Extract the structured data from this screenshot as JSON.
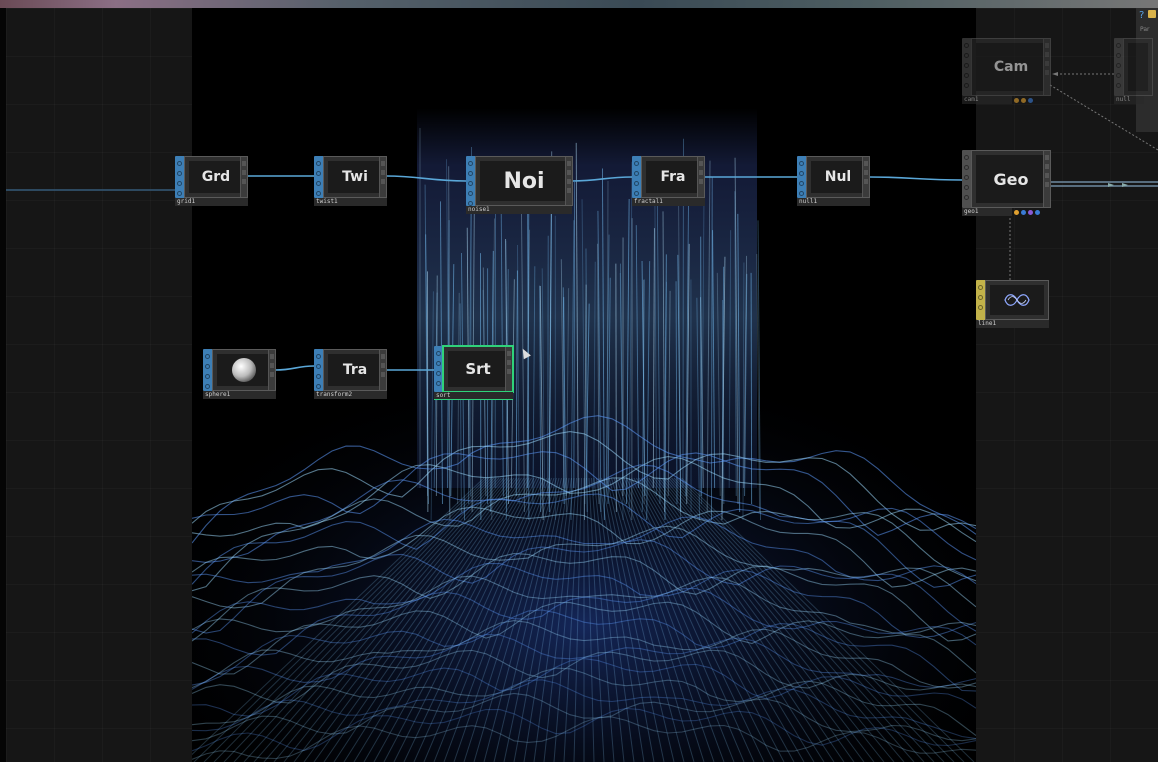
{
  "panel": {
    "help_icon": "?",
    "label": "Par"
  },
  "operators": {
    "grid": {
      "title": "Grd",
      "name": "grid1"
    },
    "twist": {
      "title": "Twi",
      "name": "twist1"
    },
    "noise": {
      "title": "Noi",
      "name": "noise1"
    },
    "fractal": {
      "title": "Fra",
      "name": "fractal1"
    },
    "null1": {
      "title": "Nul",
      "name": "null1"
    },
    "geo": {
      "title": "Geo",
      "name": "geo1"
    },
    "cam": {
      "title": "Cam",
      "name": "cam1"
    },
    "null_right": {
      "title": "",
      "name": "null"
    },
    "line": {
      "title": "",
      "name": "line1"
    },
    "sphere": {
      "title": "",
      "name": "sphere1"
    },
    "transform": {
      "title": "Tra",
      "name": "transform2"
    },
    "sort": {
      "title": "Srt",
      "name": "sort"
    }
  },
  "colors": {
    "sop_blue": "#3d7fb6",
    "dat_yellow": "#c2b24a",
    "wire": "#5aa7d8",
    "selection": "#2fd27a",
    "viz_glow": "#7cc8ff"
  }
}
